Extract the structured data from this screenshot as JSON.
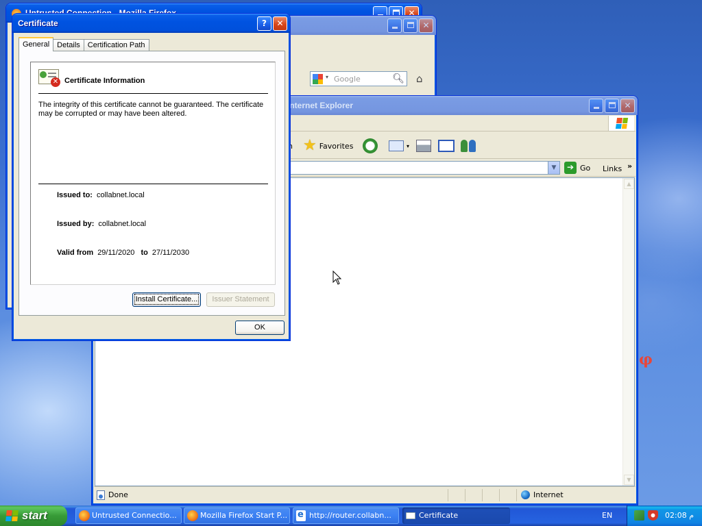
{
  "desktop": {
    "side_glyph": "φ"
  },
  "ff_back": {
    "title": "Untrusted Connection - Mozilla Firefox"
  },
  "ff_window": {
    "search_placeholder": "Google",
    "icons": {
      "reload": "reload-icon",
      "search": "magnifier-icon",
      "home": "home-icon"
    }
  },
  "ie_window": {
    "title": "Internet Explorer",
    "toolbar": {
      "search_tail": "h",
      "favorites": "Favorites"
    },
    "address": {
      "value": "",
      "go": "Go",
      "links": "Links",
      "chevron": "»"
    },
    "status": {
      "text": "Done",
      "zone": "Internet"
    }
  },
  "dialog": {
    "title": "Certificate",
    "help": "?",
    "tabs": [
      {
        "label": "General",
        "active": true
      },
      {
        "label": "Details",
        "active": false
      },
      {
        "label": "Certification Path",
        "active": false
      }
    ],
    "info_title": "Certificate Information",
    "warning": "The integrity of this certificate cannot be guaranteed. The certificate may be corrupted or may have been altered.",
    "issued_to_label": "Issued to:",
    "issued_to": "collabnet.local",
    "issued_by_label": "Issued by:",
    "issued_by": "collabnet.local",
    "valid_from_label": "Valid from",
    "valid_from": "29/11/2020",
    "valid_to_label": "to",
    "valid_to": "27/11/2030",
    "install_btn": "Install Certificate...",
    "issuer_btn": "Issuer Statement",
    "ok_btn": "OK"
  },
  "taskbar": {
    "start": "start",
    "tasks": [
      {
        "label": "Untrusted Connectio...",
        "icon": "firefox-icon",
        "active": false
      },
      {
        "label": "Mozilla Firefox Start P...",
        "icon": "firefox-icon",
        "active": false
      },
      {
        "label": "http://router.collabn...",
        "icon": "ie-icon",
        "active": false
      },
      {
        "label": "Certificate",
        "icon": "certificate-icon",
        "active": true
      }
    ],
    "lang": "EN",
    "clock": "02:08 م"
  },
  "colors": {
    "title_active": "#0053e1",
    "taskbar": "#2663e0",
    "start_green": "#379b37",
    "error_red": "#d42b1e"
  }
}
